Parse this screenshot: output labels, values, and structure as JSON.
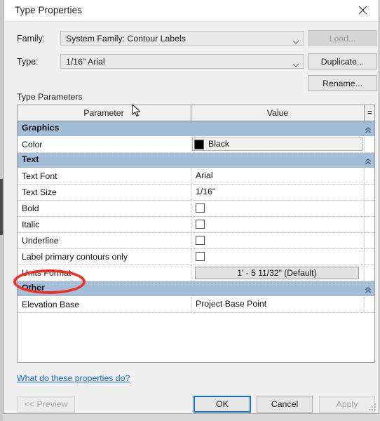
{
  "window": {
    "title": "Type Properties",
    "close_icon": "close-icon"
  },
  "form": {
    "family_label": "Family:",
    "family_value": "System Family: Contour Labels",
    "type_label": "Type:",
    "type_value": "1/16\" Arial",
    "dropdown_icon": "chevron-down-icon"
  },
  "side_buttons": {
    "load": "Load...",
    "duplicate": "Duplicate...",
    "rename": "Rename..."
  },
  "table": {
    "section_label": "Type Parameters",
    "headers": {
      "parameter": "Parameter",
      "value": "Value",
      "eq": "="
    },
    "groups": [
      {
        "name": "Graphics",
        "collapse_icon": "chevron-up-icon",
        "rows": [
          {
            "parameter": "Color",
            "kind": "color",
            "value": "Black",
            "swatch_hex": "#000000"
          }
        ]
      },
      {
        "name": "Text",
        "collapse_icon": "chevron-up-icon",
        "rows": [
          {
            "parameter": "Text Font",
            "kind": "text",
            "value": "Arial"
          },
          {
            "parameter": "Text Size",
            "kind": "text",
            "value": "1/16\""
          },
          {
            "parameter": "Bold",
            "kind": "checkbox",
            "checked": false
          },
          {
            "parameter": "Italic",
            "kind": "checkbox",
            "checked": false
          },
          {
            "parameter": "Underline",
            "kind": "checkbox",
            "checked": false
          },
          {
            "parameter": "Label primary contours only",
            "kind": "checkbox",
            "checked": false
          },
          {
            "parameter": "Units Format",
            "kind": "button",
            "value": "1' - 5 11/32\" (Default)"
          }
        ]
      },
      {
        "name": "Other",
        "collapse_icon": "chevron-up-icon",
        "rows": [
          {
            "parameter": "Elevation Base",
            "kind": "text",
            "value": "Project Base Point"
          }
        ]
      }
    ]
  },
  "help_link": "What do these properties do?",
  "footer": {
    "preview": "<< Preview",
    "ok": "OK",
    "cancel": "Cancel",
    "apply": "Apply"
  },
  "colors": {
    "group_header": "#a4bdd8",
    "accent_focus": "#0f72cf",
    "link": "#1565c0",
    "annotation": "#ee3124"
  }
}
